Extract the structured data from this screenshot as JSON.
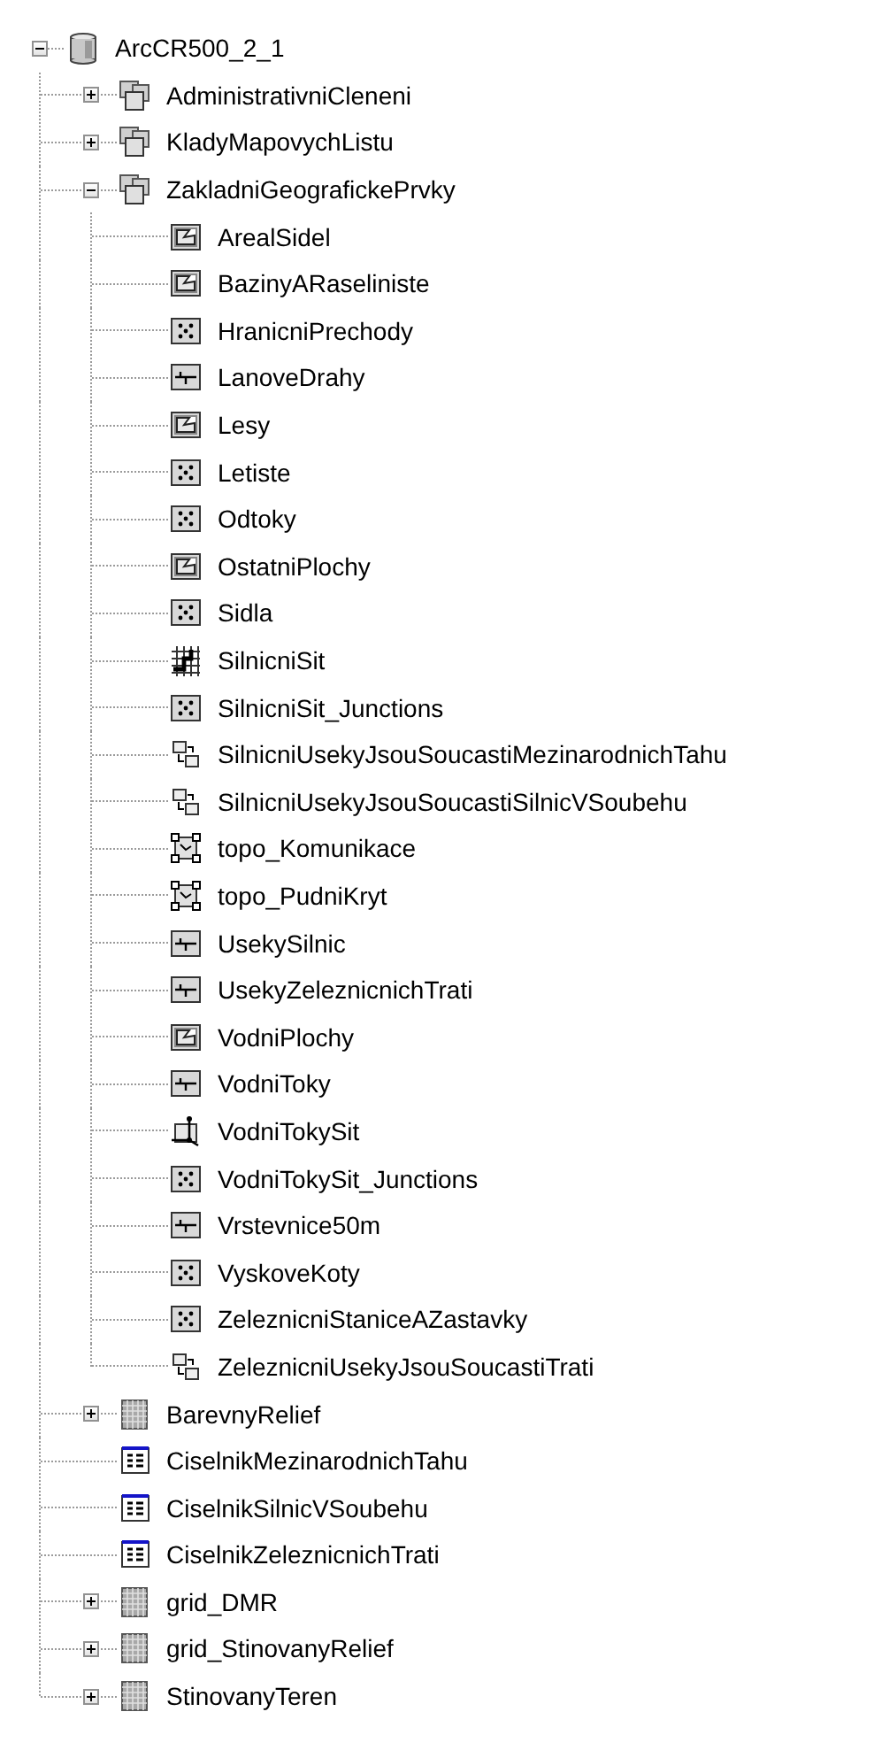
{
  "tree": {
    "label": "ArcCR500_2_1",
    "kind": "geodatabase",
    "expanded": true,
    "children": [
      {
        "label": "AdministrativniCleneni",
        "kind": "dataset",
        "expanded": false
      },
      {
        "label": "KladyMapovychListu",
        "kind": "dataset",
        "expanded": false
      },
      {
        "label": "ZakladniGeografickePrvky",
        "kind": "dataset",
        "expanded": true,
        "children": [
          {
            "label": "ArealSidel",
            "kind": "polygon"
          },
          {
            "label": "BazinyARaseliniste",
            "kind": "polygon"
          },
          {
            "label": "HranicniPrechody",
            "kind": "point"
          },
          {
            "label": "LanoveDrahy",
            "kind": "line"
          },
          {
            "label": "Lesy",
            "kind": "polygon"
          },
          {
            "label": "Letiste",
            "kind": "point"
          },
          {
            "label": "Odtoky",
            "kind": "point"
          },
          {
            "label": "OstatniPlochy",
            "kind": "polygon"
          },
          {
            "label": "Sidla",
            "kind": "point"
          },
          {
            "label": "SilnicniSit",
            "kind": "network"
          },
          {
            "label": "SilnicniSit_Junctions",
            "kind": "point"
          },
          {
            "label": "SilnicniUsekyJsouSoucastiMezinarodnichTahu",
            "kind": "relationship"
          },
          {
            "label": "SilnicniUsekyJsouSoucastiSilnicVSoubehu",
            "kind": "relationship"
          },
          {
            "label": "topo_Komunikace",
            "kind": "topology"
          },
          {
            "label": "topo_PudniKryt",
            "kind": "topology"
          },
          {
            "label": "UsekySilnic",
            "kind": "line"
          },
          {
            "label": "UsekyZeleznicnichTrati",
            "kind": "line"
          },
          {
            "label": "VodniPlochy",
            "kind": "polygon"
          },
          {
            "label": "VodniToky",
            "kind": "line"
          },
          {
            "label": "VodniTokySit",
            "kind": "geonetwork"
          },
          {
            "label": "VodniTokySit_Junctions",
            "kind": "point"
          },
          {
            "label": "Vrstevnice50m",
            "kind": "line"
          },
          {
            "label": "VyskoveKoty",
            "kind": "point"
          },
          {
            "label": "ZeleznicniStaniceAZastavky",
            "kind": "point"
          },
          {
            "label": "ZeleznicniUsekyJsouSoucastiTrati",
            "kind": "relationship"
          }
        ]
      },
      {
        "label": "BarevnyRelief",
        "kind": "raster",
        "expanded": false
      },
      {
        "label": "CiselnikMezinarodnichTahu",
        "kind": "table"
      },
      {
        "label": "CiselnikSilnicVSoubehu",
        "kind": "table"
      },
      {
        "label": "CiselnikZeleznicnichTrati",
        "kind": "table"
      },
      {
        "label": "grid_DMR",
        "kind": "raster",
        "expanded": false
      },
      {
        "label": "grid_StinovanyRelief",
        "kind": "raster",
        "expanded": false
      },
      {
        "label": "StinovanyTeren",
        "kind": "raster",
        "expanded": false
      }
    ]
  }
}
